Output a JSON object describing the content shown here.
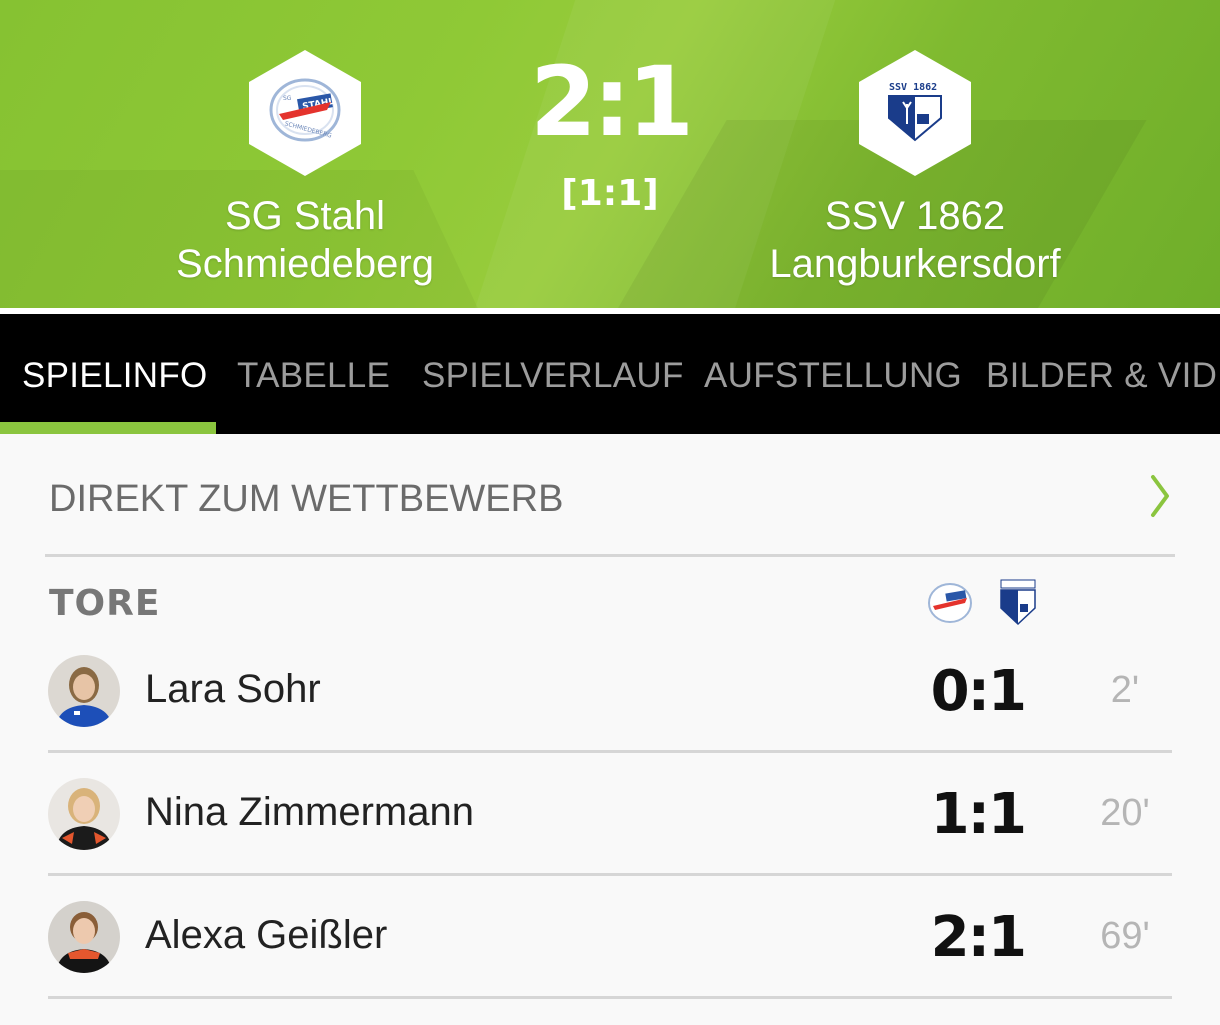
{
  "match": {
    "home_team": {
      "name_line1": "SG Stahl",
      "name_line2": "Schmiedeberg",
      "logo": "sg-stahl-logo"
    },
    "away_team": {
      "name_line1": "SSV 1862",
      "name_line2": "Langburkersdorf",
      "logo": "ssv-1862-logo"
    },
    "score": "2:1",
    "halftime": "[1:1]"
  },
  "tabs": [
    {
      "label": "SPIELINFO",
      "active": true
    },
    {
      "label": "TABELLE",
      "active": false
    },
    {
      "label": "SPIELVERLAUF",
      "active": false
    },
    {
      "label": "AUFSTELLUNG",
      "active": false
    },
    {
      "label": "BILDER & VIDE",
      "active": false
    }
  ],
  "competition_link": {
    "label": "DIREKT ZUM WETTBEWERB",
    "icon": "chevron-right-icon"
  },
  "goals": {
    "title": "TORE",
    "items": [
      {
        "player": "Lara Sohr",
        "score": "0:1",
        "minute": "2'"
      },
      {
        "player": "Nina Zimmermann",
        "score": "1:1",
        "minute": "20'"
      },
      {
        "player": "Alexa Geißler",
        "score": "2:1",
        "minute": "69'"
      }
    ]
  },
  "colors": {
    "accent": "#8bc53f",
    "tab_bar": "#000000",
    "header_green": "#8fc936"
  }
}
